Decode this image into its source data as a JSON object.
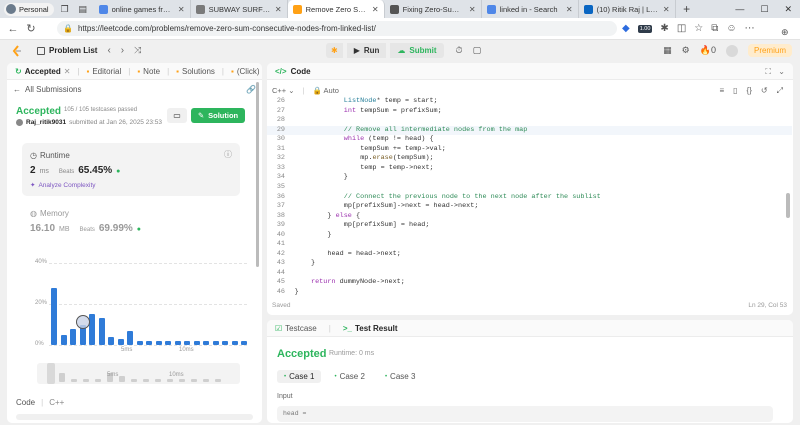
{
  "browser": {
    "profile": "Personal",
    "tabs": [
      {
        "title": "online games free play",
        "color": "#4f87e8",
        "active": false
      },
      {
        "title": "SUBWAY SURFERS - Play",
        "color": "#7a7a7a",
        "active": false
      },
      {
        "title": "Remove Zero Sum Cons",
        "color": "#ffa116",
        "active": true
      },
      {
        "title": "Fixing Zero-Sum Sublist",
        "color": "#555555",
        "active": false
      },
      {
        "title": "linked in - Search",
        "color": "#4f87e8",
        "active": false
      },
      {
        "title": "(10) Ritik Raj | LinkedIn",
        "color": "#0a66c2",
        "active": false
      }
    ],
    "url": "https://leetcode.com/problems/remove-zero-sum-consecutive-nodes-from-linked-list/",
    "badge": "1.00"
  },
  "header": {
    "problem_list": "Problem List",
    "run": "Run",
    "submit": "Submit",
    "fire_count": "0",
    "premium": "Premium"
  },
  "left": {
    "tabs": [
      {
        "label": "Accepted",
        "active": true
      },
      {
        "label": "Editorial",
        "active": false
      },
      {
        "label": "Note",
        "active": false
      },
      {
        "label": "Solutions",
        "active": false
      },
      {
        "label": "(Click)",
        "active": false
      }
    ],
    "all_submissions": "All Submissions",
    "status": "Accepted",
    "passed": "105 / 105 testcases passed",
    "user": "Raj_ritik9031",
    "submitted": "submitted at Jan 26, 2025 23:53",
    "solution_btn": "Solution",
    "runtime_label": "Runtime",
    "runtime_value": "2",
    "runtime_unit": "ms",
    "beats_label": "Beats",
    "runtime_beats": "65.45%",
    "analyze": "Analyze Complexity",
    "memory_label": "Memory",
    "memory_value": "16.10",
    "memory_unit": "MB",
    "memory_beats": "69.99%",
    "code_label": "Code",
    "lang_label": "C++"
  },
  "chart_data": {
    "type": "bar",
    "yticks": [
      "40%",
      "20%",
      "0%"
    ],
    "ylim": [
      0,
      40
    ],
    "xtick_labels": [
      "0ms",
      "5ms",
      "10ms"
    ],
    "values": [
      28,
      5,
      8,
      10,
      15,
      13,
      4,
      3,
      7,
      2,
      2,
      2,
      2,
      2,
      2,
      2,
      2,
      2,
      2,
      2,
      2
    ],
    "highlight_index": 3,
    "mini_values": [
      3,
      1,
      1,
      1,
      3,
      2,
      1,
      1,
      1,
      1,
      1,
      1,
      1,
      1
    ],
    "mini_labels": [
      "5ms",
      "10ms"
    ]
  },
  "editor": {
    "title": "Code",
    "lang": "C++",
    "mode": "Auto",
    "saved": "Saved",
    "cursor": "Ln 29, Col 53",
    "lines": [
      {
        "n": "26",
        "indent": 8,
        "text": "ListNode* temp = start;"
      },
      {
        "n": "27",
        "indent": 8,
        "text": "int tempSum = prefixSum;"
      },
      {
        "n": "28",
        "indent": 8,
        "text": ""
      },
      {
        "n": "29",
        "indent": 8,
        "text": "// Remove all intermediate nodes from the map",
        "hl": true
      },
      {
        "n": "30",
        "indent": 8,
        "text": "while (temp != head) {"
      },
      {
        "n": "31",
        "indent": 12,
        "text": "tempSum += temp->val;"
      },
      {
        "n": "32",
        "indent": 12,
        "text": "mp.erase(tempSum);"
      },
      {
        "n": "33",
        "indent": 12,
        "text": "temp = temp->next;"
      },
      {
        "n": "34",
        "indent": 8,
        "text": "}"
      },
      {
        "n": "35",
        "indent": 8,
        "text": ""
      },
      {
        "n": "36",
        "indent": 8,
        "text": "// Connect the previous node to the next node after the sublist"
      },
      {
        "n": "37",
        "indent": 8,
        "text": "mp[prefixSum]->next = head->next;"
      },
      {
        "n": "38",
        "indent": 4,
        "text": "} else {"
      },
      {
        "n": "39",
        "indent": 8,
        "text": "mp[prefixSum] = head;"
      },
      {
        "n": "40",
        "indent": 4,
        "text": "}"
      },
      {
        "n": "41",
        "indent": 0,
        "text": ""
      },
      {
        "n": "42",
        "indent": 4,
        "text": "head = head->next;"
      },
      {
        "n": "43",
        "indent": 0,
        "text": "}"
      },
      {
        "n": "44",
        "indent": 0,
        "text": ""
      },
      {
        "n": "45",
        "indent": 0,
        "text": "return dummyNode->next;"
      },
      {
        "n": "46",
        "indent": -4,
        "text": "}"
      }
    ]
  },
  "result": {
    "tab_testcase": "Testcase",
    "tab_result": "Test Result",
    "status": "Accepted",
    "runtime": "Runtime: 0 ms",
    "cases": [
      "Case 1",
      "Case 2",
      "Case 3"
    ],
    "input_label": "Input",
    "input_var": "head ="
  }
}
